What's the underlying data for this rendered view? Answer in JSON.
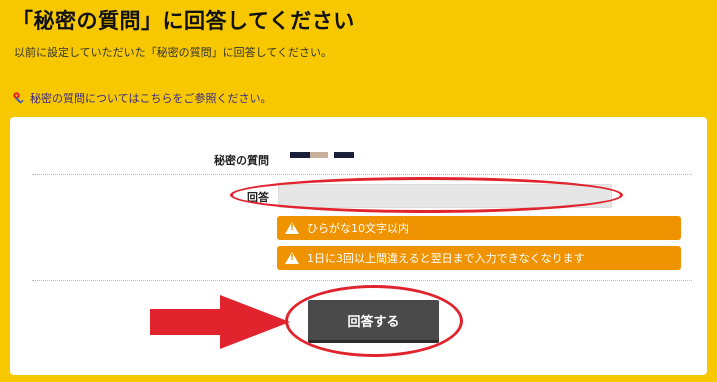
{
  "page": {
    "title": "「秘密の質問」に回答してください",
    "intro": "以前に設定していただいた「秘密の質問」に回答してください。",
    "help_link": "秘密の質問についてはこちらをご参照ください。"
  },
  "form": {
    "question_label": "秘密の質問",
    "answer_label": "回答",
    "answer_value": "",
    "answer_placeholder": "",
    "notices": [
      "ひらがな10文字以内",
      "1日に3回以上間違えると翌日まで入力できなくなります"
    ],
    "submit_label": "回答する"
  },
  "colors": {
    "background": "#f7c700",
    "notice": "#ef9400",
    "button": "#4a4a4a",
    "annotation": "#e0232d"
  },
  "icons": {
    "help": "key-icon",
    "notice": "warning-icon"
  }
}
